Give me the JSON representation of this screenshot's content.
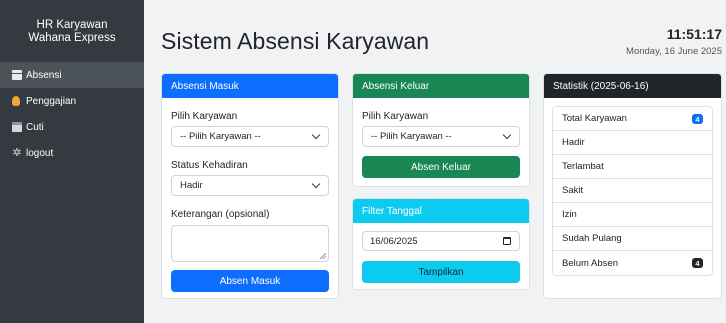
{
  "sidebar": {
    "brand_line1": "HR Karyawan",
    "brand_line2": "Wahana Express",
    "items": [
      {
        "label": "Absensi",
        "icon": "table-icon",
        "active": true
      },
      {
        "label": "Penggajian",
        "icon": "money-bag-icon",
        "active": false
      },
      {
        "label": "Cuti",
        "icon": "calendar-icon",
        "active": false
      },
      {
        "label": "logout",
        "icon": "gear-icon",
        "active": false
      }
    ]
  },
  "header": {
    "title": "Sistem Absensi Karyawan",
    "time": "11:51:17",
    "date": "Monday, 16 June 2025"
  },
  "absen_masuk": {
    "title": "Absensi Masuk",
    "employee_label": "Pilih Karyawan",
    "employee_value": "-- Pilih Karyawan --",
    "status_label": "Status Kehadiran",
    "status_value": "Hadir",
    "note_label": "Keterangan (opsional)",
    "note_value": "",
    "submit_label": "Absen Masuk"
  },
  "absen_keluar": {
    "title": "Absensi Keluar",
    "employee_label": "Pilih Karyawan",
    "employee_value": "-- Pilih Karyawan --",
    "submit_label": "Absen Keluar"
  },
  "filter": {
    "title": "Filter Tanggal",
    "date_value": "16/06/2025",
    "submit_label": "Tampilkan"
  },
  "stats": {
    "title": "Statistik (2025-06-16)",
    "items": [
      {
        "label": "Total Karyawan",
        "badge": "4",
        "badge_color": "#0d6efd"
      },
      {
        "label": "Hadir",
        "badge": null
      },
      {
        "label": "Terlambat",
        "badge": null
      },
      {
        "label": "Sakit",
        "badge": null
      },
      {
        "label": "Izin",
        "badge": null
      },
      {
        "label": "Sudah Pulang",
        "badge": null
      },
      {
        "label": "Belum Absen",
        "badge": "4",
        "badge_color": "#212529"
      }
    ]
  },
  "colors": {
    "sidebar_bg": "#343a40",
    "primary": "#0d6efd",
    "success": "#198754",
    "info": "#0dcaf0",
    "dark": "#212529"
  }
}
